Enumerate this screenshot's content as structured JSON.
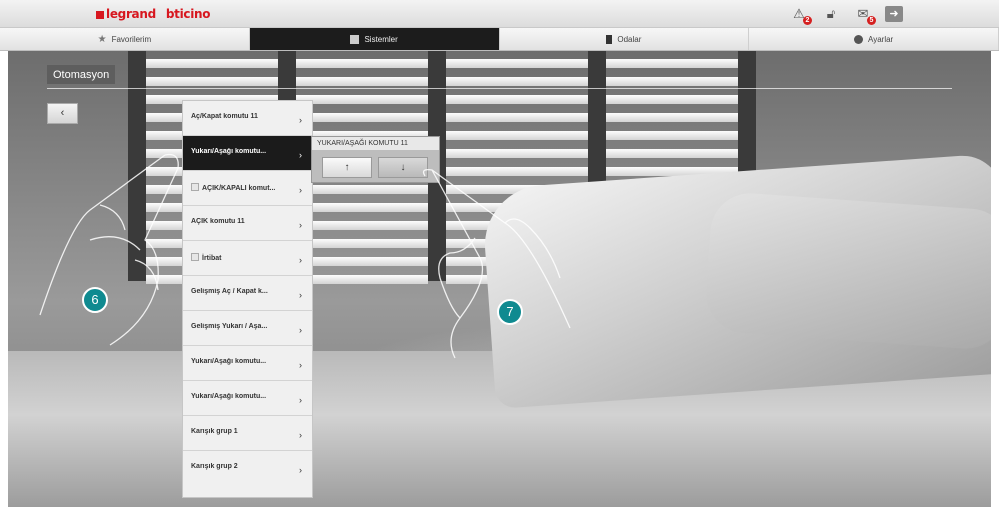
{
  "brand": {
    "legrand": "legrand",
    "bticino": "bticino"
  },
  "topbar": {
    "icons": [
      {
        "name": "alarm-icon",
        "badge": "2"
      },
      {
        "name": "lock-icon",
        "badge": ""
      },
      {
        "name": "message-icon",
        "badge": "5"
      },
      {
        "name": "exit-icon",
        "badge": ""
      }
    ]
  },
  "nav": {
    "tabs": [
      "Favorilerim",
      "Sistemler",
      "Odalar",
      "Ayarlar"
    ]
  },
  "page": {
    "title": "Otomasyon",
    "back": "‹"
  },
  "menu": {
    "items": [
      "Aç/Kapat komutu 11",
      "Yukarı/Aşağı komutu...",
      "AÇIK/KAPALI komut...",
      "AÇIK komutu 11",
      "İrtibat",
      "Gelişmiş Aç / Kapat k...",
      "Gelişmiş Yukarı / Aşa...",
      "Yukarı/Aşağı komutu...",
      "Yukarı/Aşağı komutu...",
      "Karışık grup 1",
      "Karışık grup 2"
    ],
    "chevron": "›"
  },
  "panel": {
    "title": "YUKARI/AŞAĞI KOMUTU 11",
    "up": "↑",
    "down": "↓"
  },
  "callouts": {
    "first": "6",
    "second": "7"
  },
  "colors": {
    "callout": "#0f8a90",
    "brand_red": "#d7171f",
    "active_tab": "#1c1c1c"
  }
}
